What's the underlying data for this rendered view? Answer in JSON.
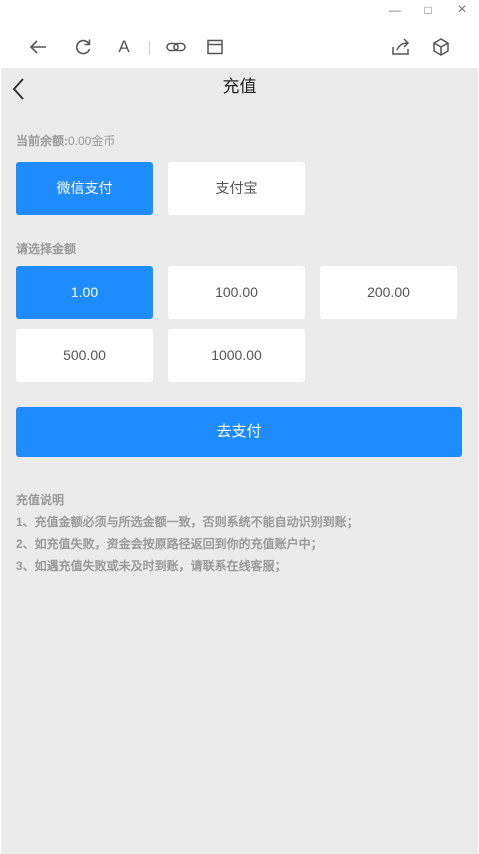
{
  "window": {
    "minimize_glyph": "—",
    "maximize_glyph": "□",
    "close_glyph": "×"
  },
  "toolbar": {
    "icons": [
      "back-arrow-icon",
      "refresh-icon",
      "font-size-icon",
      "link-icon",
      "window-icon",
      "share-icon",
      "cube-icon"
    ],
    "font_label": "A"
  },
  "nav": {
    "title": "充值"
  },
  "balance": {
    "label": "当前余额:",
    "value": "0.00金币"
  },
  "payment_methods": [
    {
      "label": "微信支付",
      "selected": true
    },
    {
      "label": "支付宝",
      "selected": false
    }
  ],
  "amount_section": {
    "label": "请选择金额",
    "amounts": [
      {
        "label": "1.00",
        "selected": true
      },
      {
        "label": "100.00",
        "selected": false
      },
      {
        "label": "200.00",
        "selected": false
      },
      {
        "label": "500.00",
        "selected": false
      },
      {
        "label": "1000.00",
        "selected": false
      }
    ]
  },
  "pay_button": {
    "label": "去支付"
  },
  "notes": {
    "title": "充值说明",
    "items": [
      "1、充值金额必须与所选金额一致，否则系统不能自动识别到账；",
      "2、如充值失败，资金会按原路径返回到你的充值账户中；",
      "3、如遇充值失败或未及时到账，请联系在线客服；"
    ]
  },
  "colors": {
    "accent": "#1e8cff",
    "page_background": "#ebebeb",
    "muted_text": "#9a9a9a"
  }
}
